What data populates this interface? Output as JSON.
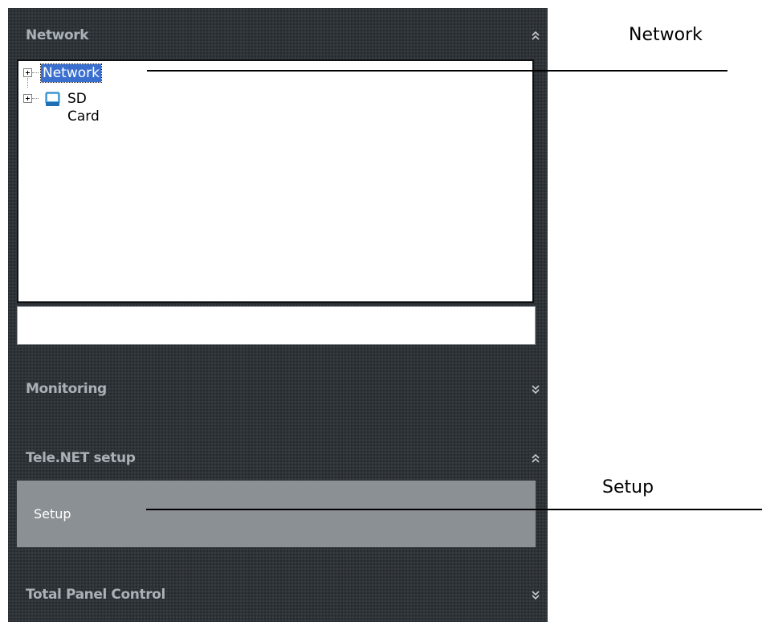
{
  "panel": {
    "network_section": {
      "title": "Network",
      "chevron": "⌃⌃"
    },
    "tree": {
      "nodes": [
        {
          "label": "Network",
          "selected": true,
          "icon": "none"
        },
        {
          "label": "SD Card",
          "selected": false,
          "icon": "sd-card-icon"
        }
      ]
    },
    "path_input": {
      "value": "",
      "placeholder": ""
    },
    "monitoring_section": {
      "title": "Monitoring",
      "chevron": "⌄⌄"
    },
    "telenet_section": {
      "title": "Tele.NET setup",
      "chevron": "⌃⌃"
    },
    "setup_item": {
      "label": "Setup"
    },
    "total_panel_section": {
      "title": "Total Panel Control",
      "chevron": "⌄⌄"
    }
  },
  "callouts": {
    "network": "Network",
    "setup": "Setup"
  },
  "colors": {
    "panel_bg": "#2e3338",
    "header_text": "#a9b0b6",
    "selection": "#3a6fd0",
    "setup_item_bg": "#8b9095"
  }
}
